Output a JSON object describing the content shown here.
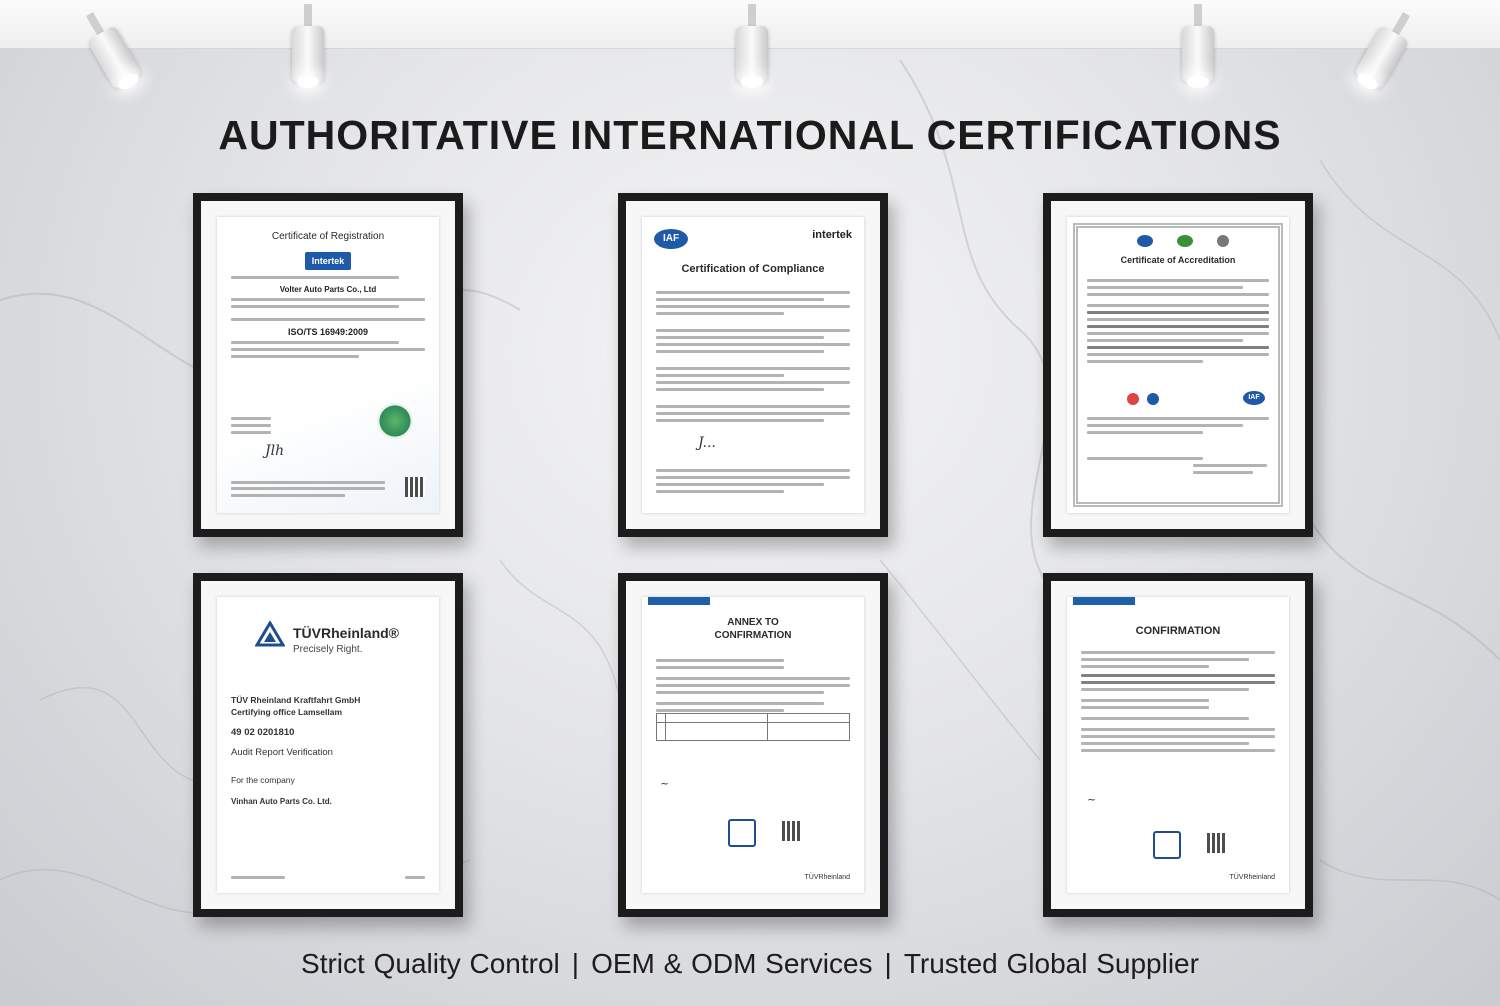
{
  "headline": "AUTHORITATIVE INTERNATIONAL CERTIFICATIONS",
  "tagline": {
    "items": [
      "Strict Quality Control",
      "OEM & ODM Services",
      "Trusted Global Supplier"
    ],
    "separator": "|"
  },
  "certificates": [
    {
      "title": "Certificate of Registration",
      "logo": "Intertek",
      "company": "Volter Auto Parts Co., Ltd",
      "standard": "ISO/TS 16949:2009",
      "signature": "Jlh"
    },
    {
      "badge": "IAF",
      "brand": "intertek",
      "title": "Certification of Compliance",
      "signature": "J..."
    },
    {
      "title": "Certificate of Accreditation",
      "badge": "IAF"
    },
    {
      "brand": "TÜVRheinland®",
      "slogan": "Precisely Right.",
      "issuer_line1": "TÜV Rheinland Kraftfahrt GmbH",
      "issuer_line2": "Certifying office Lamsellam",
      "number": "49 02 0201810",
      "heading": "Audit Report Verification",
      "for_label": "For the company",
      "company": "Vinhan Auto Parts Co. Ltd."
    },
    {
      "title_line1": "ANNEX TO",
      "title_line2": "CONFIRMATION",
      "footer_brand": "TÜVRheinland"
    },
    {
      "title": "CONFIRMATION",
      "footer_brand": "TÜVRheinland"
    }
  ],
  "colors": {
    "frame": "#1c1c1c",
    "intertek_blue": "#1e5aa8",
    "tuv_blue": "#1f4e8c",
    "text": "#1b1b1b"
  },
  "icons": [
    "spotlight-icon",
    "globe-seal-icon",
    "qr-code-icon",
    "tuv-triangle-icon"
  ]
}
